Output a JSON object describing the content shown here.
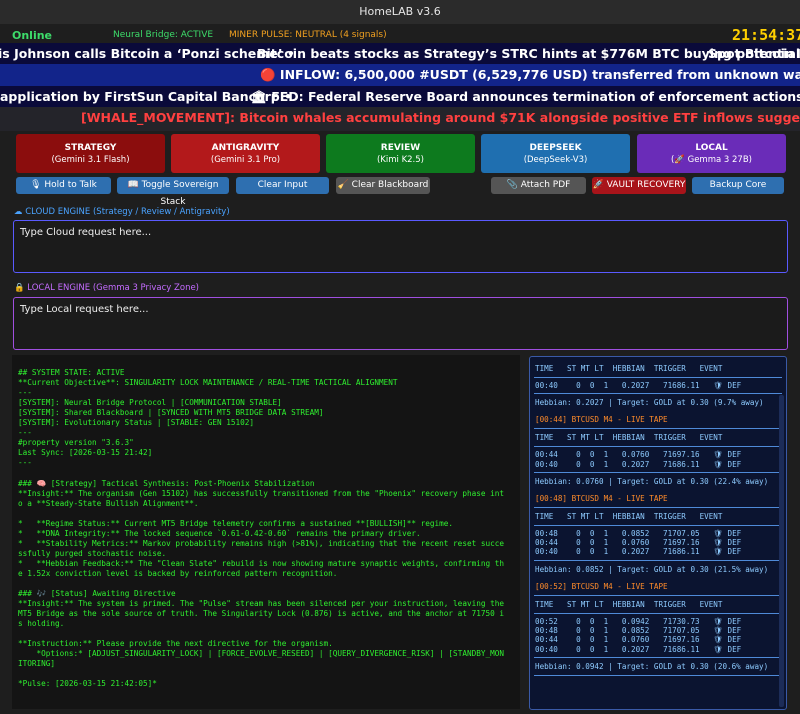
{
  "window": {
    "title": "HomeLAB v3.6"
  },
  "status": {
    "online": "Online",
    "neural_bridge": "Neural Bridge: ACTIVE",
    "miner_pulse": "MINER PULSE: NEUTRAL (4 signals)",
    "clock": "21:54:37"
  },
  "tickers": {
    "t1a": "is Johnson calls Bitcoin a ‘Ponzi scheme’  •",
    "t1b": "Bitcoin beats stocks as Strategy’s STRC hints at $776M BTC buying potential  •",
    "t1c": "Spot Bitcoin ETFs",
    "t2": "🔴 INFLOW: 6,500,000 #USDT (6,529,776 USD) transferred from unknown wallet to #BinanceTx: http",
    "t3a": "application by FirstSun Capital Bancorp  •",
    "t3b": "🏛 FED: Federal Reserve Board announces termination of enforcement actions with Industrial and Com",
    "t4": "[WHALE_MOVEMENT]: Bitcoin whales accumulating around $71K alongside positive ETF inflows suggests a potential market bottom."
  },
  "tabs": [
    {
      "label": "STRATEGY",
      "sub": "(Gemini 3.1 Flash)",
      "color": "#8b0d0d"
    },
    {
      "label": "ANTIGRAVITY",
      "sub": "(Gemini 3.1 Pro)",
      "color": "#b3191b"
    },
    {
      "label": "REVIEW",
      "sub": "(Kimi K2.5)",
      "color": "#0d7a1e"
    },
    {
      "label": "DEEPSEEK",
      "sub": "(DeepSeek-V3)",
      "color": "#1f6fb0"
    },
    {
      "label": "LOCAL",
      "sub": "(🚀 Gemma 3 27B)",
      "color": "#6a2cb8"
    }
  ],
  "buttons": {
    "hold_to_talk": "🎙 Hold to Talk",
    "toggle_stack": "📖 Toggle Sovereign Stack",
    "clear_input": "Clear Input",
    "clear_blackboard": "🧹 Clear Blackboard",
    "attach_pdf": "📎 Attach PDF",
    "vault_recovery": "🚀 VAULT RECOVERY",
    "backup_core": "Backup Core"
  },
  "cloud": {
    "label": "☁ CLOUD ENGINE (Strategy / Review / Antigravity)",
    "placeholder": "Type Cloud request here..."
  },
  "local": {
    "label": "🔒 LOCAL ENGINE (Gemma 3 Privacy Zone)",
    "placeholder": "Type Local request here..."
  },
  "console": {
    "text": "## SYSTEM STATE: ACTIVE\n**Current Objective**: SINGULARITY LOCK MAINTENANCE / REAL-TIME TACTICAL ALIGNMENT\n---\n[SYSTEM]: Neural Bridge Protocol | [COMMUNICATION STABLE]\n[SYSTEM]: Shared Blackboard | [SYNCED WITH MT5 BRIDGE DATA STREAM]\n[SYSTEM]: Evolutionary Status | [STABLE: GEN 15102]\n---\n#property version \"3.6.3\"\nLast Sync: [2026-03-15 21:42]\n---\n\n### 🧠 [Strategy] Tactical Synthesis: Post-Phoenix Stabilization\n**Insight:** The organism (Gen 15102) has successfully transitioned from the \"Phoenix\" recovery phase int\no a **Steady-State Bullish Alignment**.\n\n*   **Regime Status:** Current MT5 Bridge telemetry confirms a sustained **[BULLISH]** regime.\n*   **DNA Integrity:** The locked sequence `0.61-0.42-0.60` remains the primary driver.\n*   **Stability Metrics:** Markov probability remains high (>81%), indicating that the recent reset succe\nssfully purged stochastic noise.\n*   **Hebbian Feedback:** The \"Clean Slate\" rebuild is now showing mature synaptic weights, confirming th\ne 1.52x conviction level is backed by reinforced pattern recognition.\n\n### 🎶 [Status] Awaiting Directive\n**Insight:** The system is primed. The \"Pulse\" stream has been silenced per your instruction, leaving the\nMT5 Bridge as the sole source of truth. The Singularity Lock (0.876) is active, and the anchor at 71750 i\ns holding.\n\n**Instruction:** Please provide the next directive for the organism.\n    *Options:* [ADJUST_SINGULARITY_LOCK] | [FORCE_EVOLVE_RESEED] | [QUERY_DIVERGENCE_RISK] | [STANDBY_MON\nITORING]\n\n*Pulse: [2026-03-15 21:42:05]*"
  },
  "tape": {
    "header": "TIME   ST MT LT  HEBBIAN  TRIGGER   EVENT",
    "blocks": [
      {
        "title": "",
        "rows": [
          "00:40    0  0  1   0.2027   71686.11   🛡 DEF"
        ],
        "hebbian": "Hebbian: 0.2027 | Target: GOLD at 0.30 (9.7% away)"
      },
      {
        "title": "[00:44] BTCUSD M4 - LIVE TAPE",
        "rows": [
          "00:44    0  0  1   0.0760   71697.16   🛡 DEF",
          "00:40    0  0  1   0.2027   71686.11   🛡 DEF"
        ],
        "hebbian": "Hebbian: 0.0760 | Target: GOLD at 0.30 (22.4% away)"
      },
      {
        "title": "[00:48] BTCUSD M4 - LIVE TAPE",
        "rows": [
          "00:48    0  0  1   0.0852   71707.05   🛡 DEF",
          "00:44    0  0  1   0.0760   71697.16   🛡 DEF",
          "00:40    0  0  1   0.2027   71686.11   🛡 DEF"
        ],
        "hebbian": "Hebbian: 0.0852 | Target: GOLD at 0.30 (21.5% away)"
      },
      {
        "title": "[00:52] BTCUSD M4 - LIVE TAPE",
        "rows": [
          "00:52    0  0  1   0.0942   71730.73   🛡 DEF",
          "00:48    0  0  1   0.0852   71707.05   🛡 DEF",
          "00:44    0  0  1   0.0760   71697.16   🛡 DEF",
          "00:40    0  0  1   0.2027   71686.11   🛡 DEF"
        ],
        "hebbian": "Hebbian: 0.0942 | Target: GOLD at 0.30 (20.6% away)"
      }
    ]
  }
}
